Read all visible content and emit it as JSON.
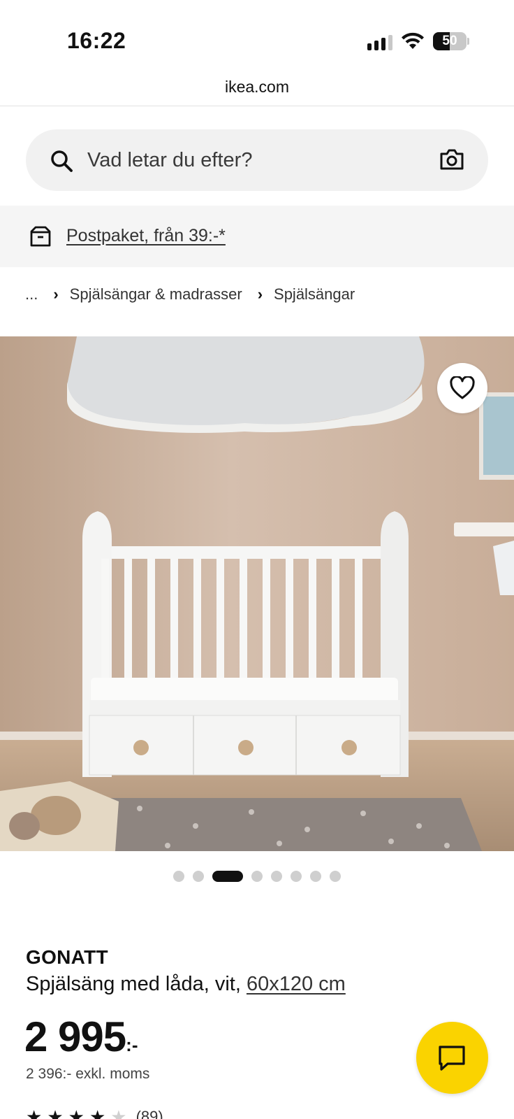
{
  "status_bar": {
    "time": "16:22",
    "battery_level": "50",
    "battery_fraction": 0.5
  },
  "browser": {
    "url": "ikea.com"
  },
  "search": {
    "placeholder": "Vad letar du efter?",
    "icon": "search-icon",
    "camera_icon": "camera-icon"
  },
  "shipping_banner": {
    "text": "Postpaket, från 39:-*",
    "icon": "parcel-box-icon"
  },
  "breadcrumb": {
    "ellipsis": "...",
    "items": [
      "Spjälsängar & madrasser",
      "Spjälsängar"
    ]
  },
  "gallery": {
    "image_count": 8,
    "active_index": 2,
    "favorite_icon": "heart-icon"
  },
  "product": {
    "name": "GONATT",
    "description": "Spjälsäng med låda, vit,",
    "size": "60x120 cm",
    "price": "2 995",
    "price_suffix": ":-",
    "price_ex_vat": "2 396:- exkl. moms",
    "rating": 4,
    "rating_max": 5,
    "review_count": "(89)"
  },
  "chat": {
    "icon": "chat-bubble-icon"
  },
  "colors": {
    "ikea_yellow": "#fad300",
    "text": "#111111",
    "background_gray": "#f5f5f5"
  }
}
